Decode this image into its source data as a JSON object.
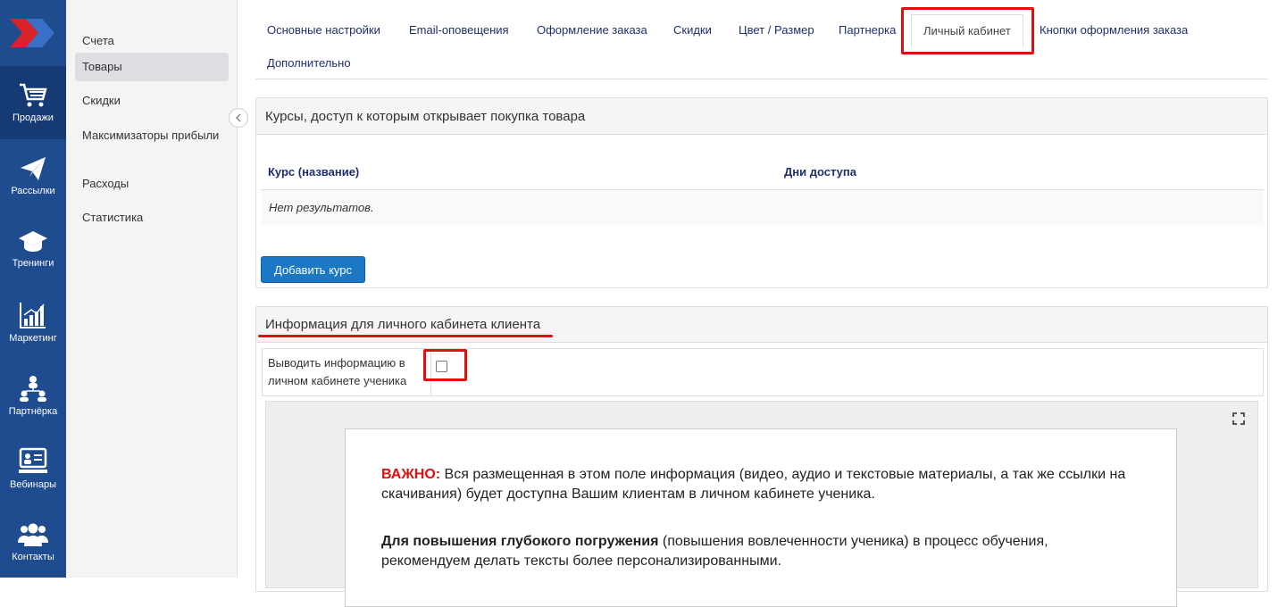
{
  "rail": {
    "items": [
      {
        "label": "Продажи",
        "icon": "cart-icon"
      },
      {
        "label": "Рассылки",
        "icon": "paper-plane-icon"
      },
      {
        "label": "Тренинги",
        "icon": "graduation-cap-icon"
      },
      {
        "label": "Маркетинг",
        "icon": "chart-icon"
      },
      {
        "label": "Партнёрка",
        "icon": "network-icon"
      },
      {
        "label": "Вебинары",
        "icon": "presentation-icon"
      },
      {
        "label": "Контакты",
        "icon": "users-icon"
      }
    ],
    "active": "Продажи"
  },
  "submenu": {
    "items": [
      "Счета",
      "Товары",
      "Скидки",
      "Максимизаторы прибыли",
      "Расходы",
      "Статистика"
    ],
    "active": "Товары"
  },
  "tabs": {
    "items": [
      "Основные настройки",
      "Email-оповещения",
      "Оформление заказа",
      "Скидки",
      "Цвет / Размер",
      "Партнерка",
      "Личный кабинет",
      "Кнопки оформления заказа",
      "Дополнительно"
    ],
    "active": "Личный кабинет"
  },
  "courses_panel": {
    "title": "Курсы, доступ к которым открывает покупка товара",
    "col_course": "Курс (название)",
    "col_days": "Дни доступа",
    "empty_text": "Нет результатов.",
    "add_button": "Добавить курс"
  },
  "cabinet_panel": {
    "title": "Информация для личного кабинета клиента",
    "show_label": "Выводить информацию в личном кабинете ученика",
    "show_checked": false,
    "editor": {
      "warn_label": "ВАЖНО:",
      "warn_text": " Вся размещенная в этом поле информация (видео, аудио и текстовые материалы, а так же ссылки на скачивания) будет доступна Вашим клиентам в личном кабинете ученика.",
      "bold_text": "Для повышения глубокого погружения",
      "rest_text": " (повышения вовлеченности ученика) в процесс обучения, рекомендуем делать тексты более персонализированными."
    }
  },
  "colors": {
    "rail": "#1f4b8f",
    "accent": "#1b78c5",
    "highlight": "#e01010",
    "tab_text": "#1e2f6e"
  }
}
